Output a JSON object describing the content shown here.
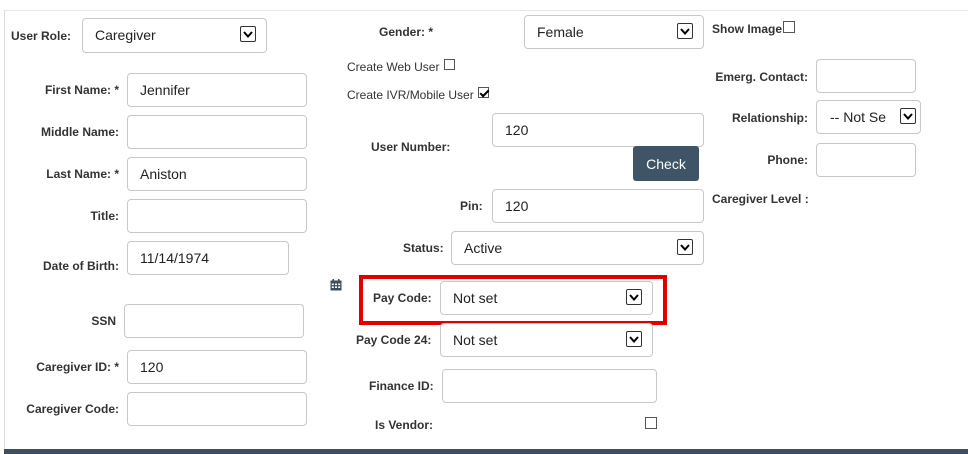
{
  "left": {
    "user_role_label": "User Role:",
    "user_role_value": "Caregiver",
    "first_name_label": "First Name: *",
    "first_name_value": "Jennifer",
    "middle_name_label": "Middle Name:",
    "middle_name_value": "",
    "last_name_label": "Last Name: *",
    "last_name_value": "Aniston",
    "title_label": "Title:",
    "title_value": "",
    "dob_label": "Date of Birth:",
    "dob_value": "11/14/1974",
    "ssn_label": "SSN",
    "ssn_value": "",
    "caregiver_id_label": "Caregiver ID: *",
    "caregiver_id_value": "120",
    "caregiver_code_label": "Caregiver Code:",
    "caregiver_code_value": ""
  },
  "middle": {
    "gender_label": "Gender: *",
    "gender_value": "Female",
    "create_web_user_label": "Create Web User",
    "create_web_user_checked": false,
    "create_ivr_label": "Create IVR/Mobile User",
    "create_ivr_checked": true,
    "user_number_label": "User Number:",
    "user_number_value": "120",
    "check_button": "Check",
    "pin_label": "Pin:",
    "pin_value": "120",
    "status_label": "Status:",
    "status_value": "Active",
    "pay_code_label": "Pay Code:",
    "pay_code_value": "Not set",
    "pay_code_24_label": "Pay Code 24:",
    "pay_code_24_value": "Not set",
    "finance_id_label": "Finance ID:",
    "finance_id_value": "",
    "is_vendor_label": "Is Vendor:",
    "is_vendor_checked": false
  },
  "right": {
    "show_image_label": "Show Image",
    "show_image_checked": false,
    "emerg_contact_label": "Emerg. Contact:",
    "emerg_contact_value": "",
    "relationship_label": "Relationship:",
    "relationship_value": "-- Not Se",
    "phone_label": "Phone:",
    "phone_value": "",
    "caregiver_level_label": "Caregiver Level :"
  },
  "colors": {
    "highlight": "#e00000",
    "button": "#3f5466",
    "bottom_bar": "#3d4f5e"
  },
  "icons": {
    "calendar": "calendar-icon",
    "select_arrow": "chevron-down-icon"
  }
}
